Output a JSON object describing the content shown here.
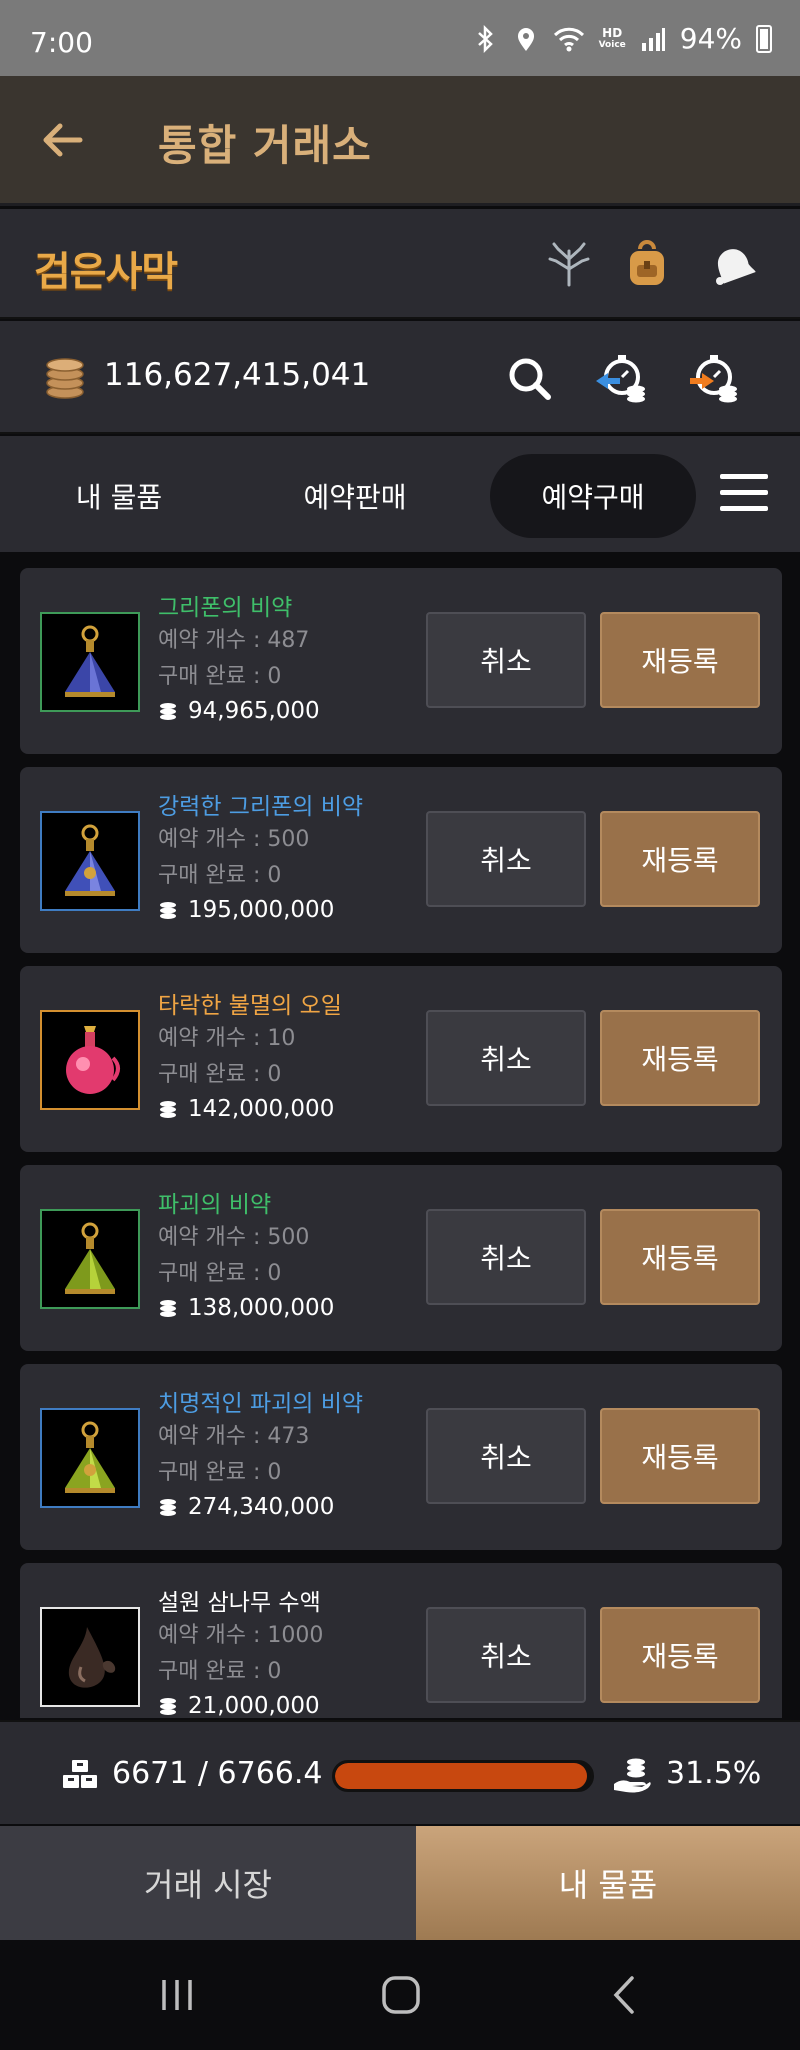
{
  "status_bar": {
    "time": "7:00",
    "battery": "94%",
    "hd_label": "HD",
    "hd_sub": "Voice"
  },
  "header": {
    "title": "통합 거래소"
  },
  "brand": {
    "logo_text": "검은사막"
  },
  "currency": {
    "silver": "116,627,415,041"
  },
  "tabs": [
    {
      "label": "내 물품",
      "active": false
    },
    {
      "label": "예약판매",
      "active": false
    },
    {
      "label": "예약구매",
      "active": true
    }
  ],
  "buttons": {
    "cancel": "취소",
    "relist": "재등록"
  },
  "items": [
    {
      "name": "그리폰의 비약",
      "name_color": "#3fbf6a",
      "border_color": "#3e9a58",
      "icon": "blue-potion-icon",
      "reserve": "예약 개수 : 487",
      "complete": "구매 완료 : 0",
      "price": "94,965,000"
    },
    {
      "name": "강력한 그리폰의 비약",
      "name_color": "#4d9de3",
      "border_color": "#3f7cc2",
      "icon": "blue-potion-icon",
      "reserve": "예약 개수 : 500",
      "complete": "구매 완료 : 0",
      "price": "195,000,000"
    },
    {
      "name": "타락한 불멸의 오일",
      "name_color": "#f0a544",
      "border_color": "#d49030",
      "icon": "red-oil-icon",
      "reserve": "예약 개수 : 10",
      "complete": "구매 완료 : 0",
      "price": "142,000,000"
    },
    {
      "name": "파괴의 비약",
      "name_color": "#3fbf6a",
      "border_color": "#3e9a58",
      "icon": "green-potion-icon",
      "reserve": "예약 개수 : 500",
      "complete": "구매 완료 : 0",
      "price": "138,000,000"
    },
    {
      "name": "치명적인 파괴의 비약",
      "name_color": "#4d9de3",
      "border_color": "#3f7cc2",
      "icon": "green-potion-icon",
      "reserve": "예약 개수 : 473",
      "complete": "구매 완료 : 0",
      "price": "274,340,000"
    },
    {
      "name": "설원 삼나무 수액",
      "name_color": "#ffffff",
      "border_color": "#e6e6e6",
      "icon": "sap-drop-icon",
      "reserve": "예약 개수 : 1000",
      "complete": "구매 완료 : 0",
      "price": "21,000,000"
    }
  ],
  "weight": {
    "text": "6671 / 6766.4",
    "fill_fraction": 0.986
  },
  "tax": {
    "text": "31.5%"
  },
  "bottom_tabs": {
    "market": "거래 시장",
    "mine": "내 물품"
  },
  "colors": {
    "accent_gold": "#d9b07a",
    "relist_bg": "#99714a",
    "progress": "#c8480f"
  }
}
